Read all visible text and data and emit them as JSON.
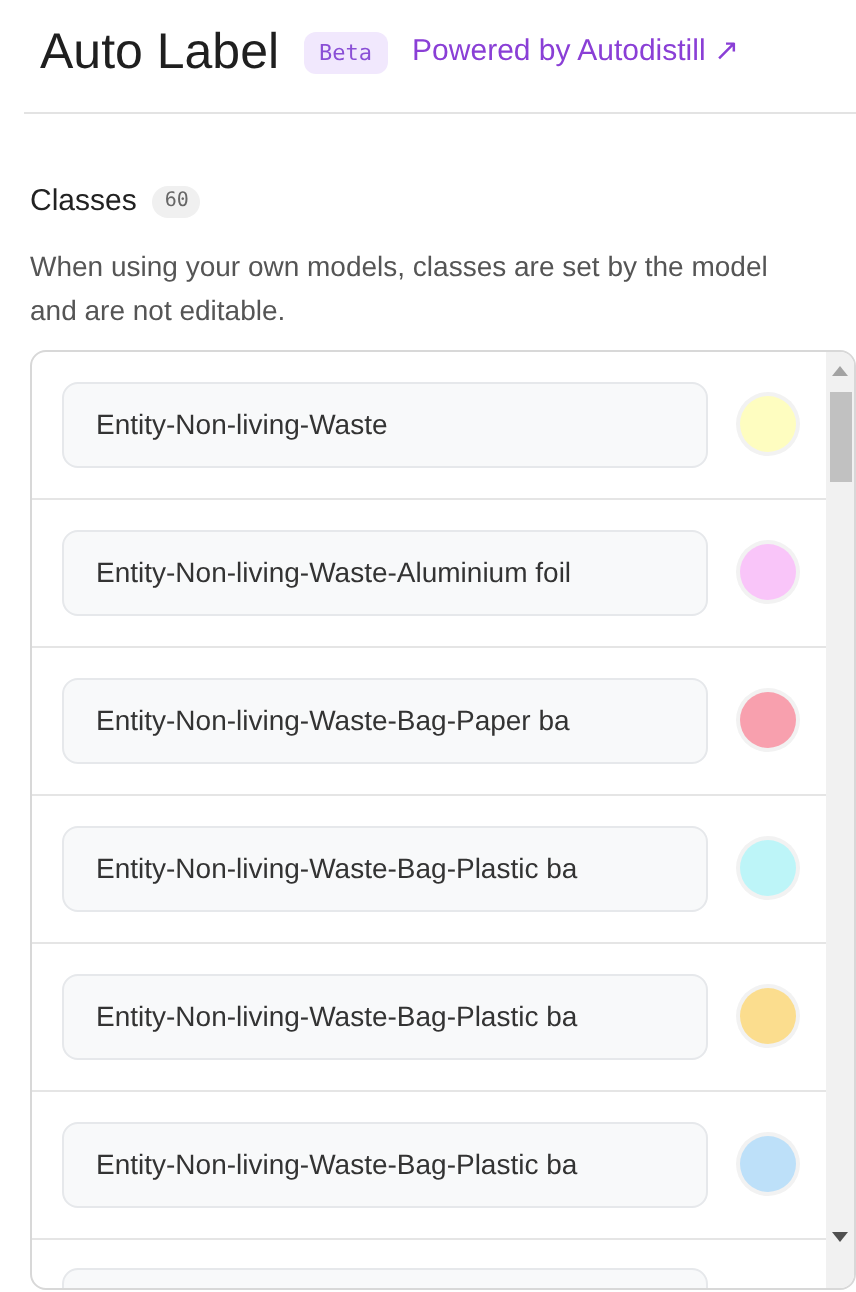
{
  "header": {
    "title": "Auto Label",
    "badge": "Beta",
    "link": "Powered by Autodistill ↗"
  },
  "classes": {
    "heading": "Classes",
    "count": "60",
    "description": "When using your own models, classes are set by the model and are not editable.",
    "items": [
      {
        "name": "Entity-Non-living-Waste",
        "color": "#fefdc0"
      },
      {
        "name": "Entity-Non-living-Waste-Aluminium foil",
        "color": "#f9c5f9"
      },
      {
        "name": "Entity-Non-living-Waste-Bag-Paper ba",
        "color": "#f8a0ae"
      },
      {
        "name": "Entity-Non-living-Waste-Bag-Plastic ba",
        "color": "#bdf5f8"
      },
      {
        "name": "Entity-Non-living-Waste-Bag-Plastic ba",
        "color": "#fbdd8e"
      },
      {
        "name": "Entity-Non-living-Waste-Bag-Plastic ba",
        "color": "#bde0f9"
      }
    ]
  }
}
